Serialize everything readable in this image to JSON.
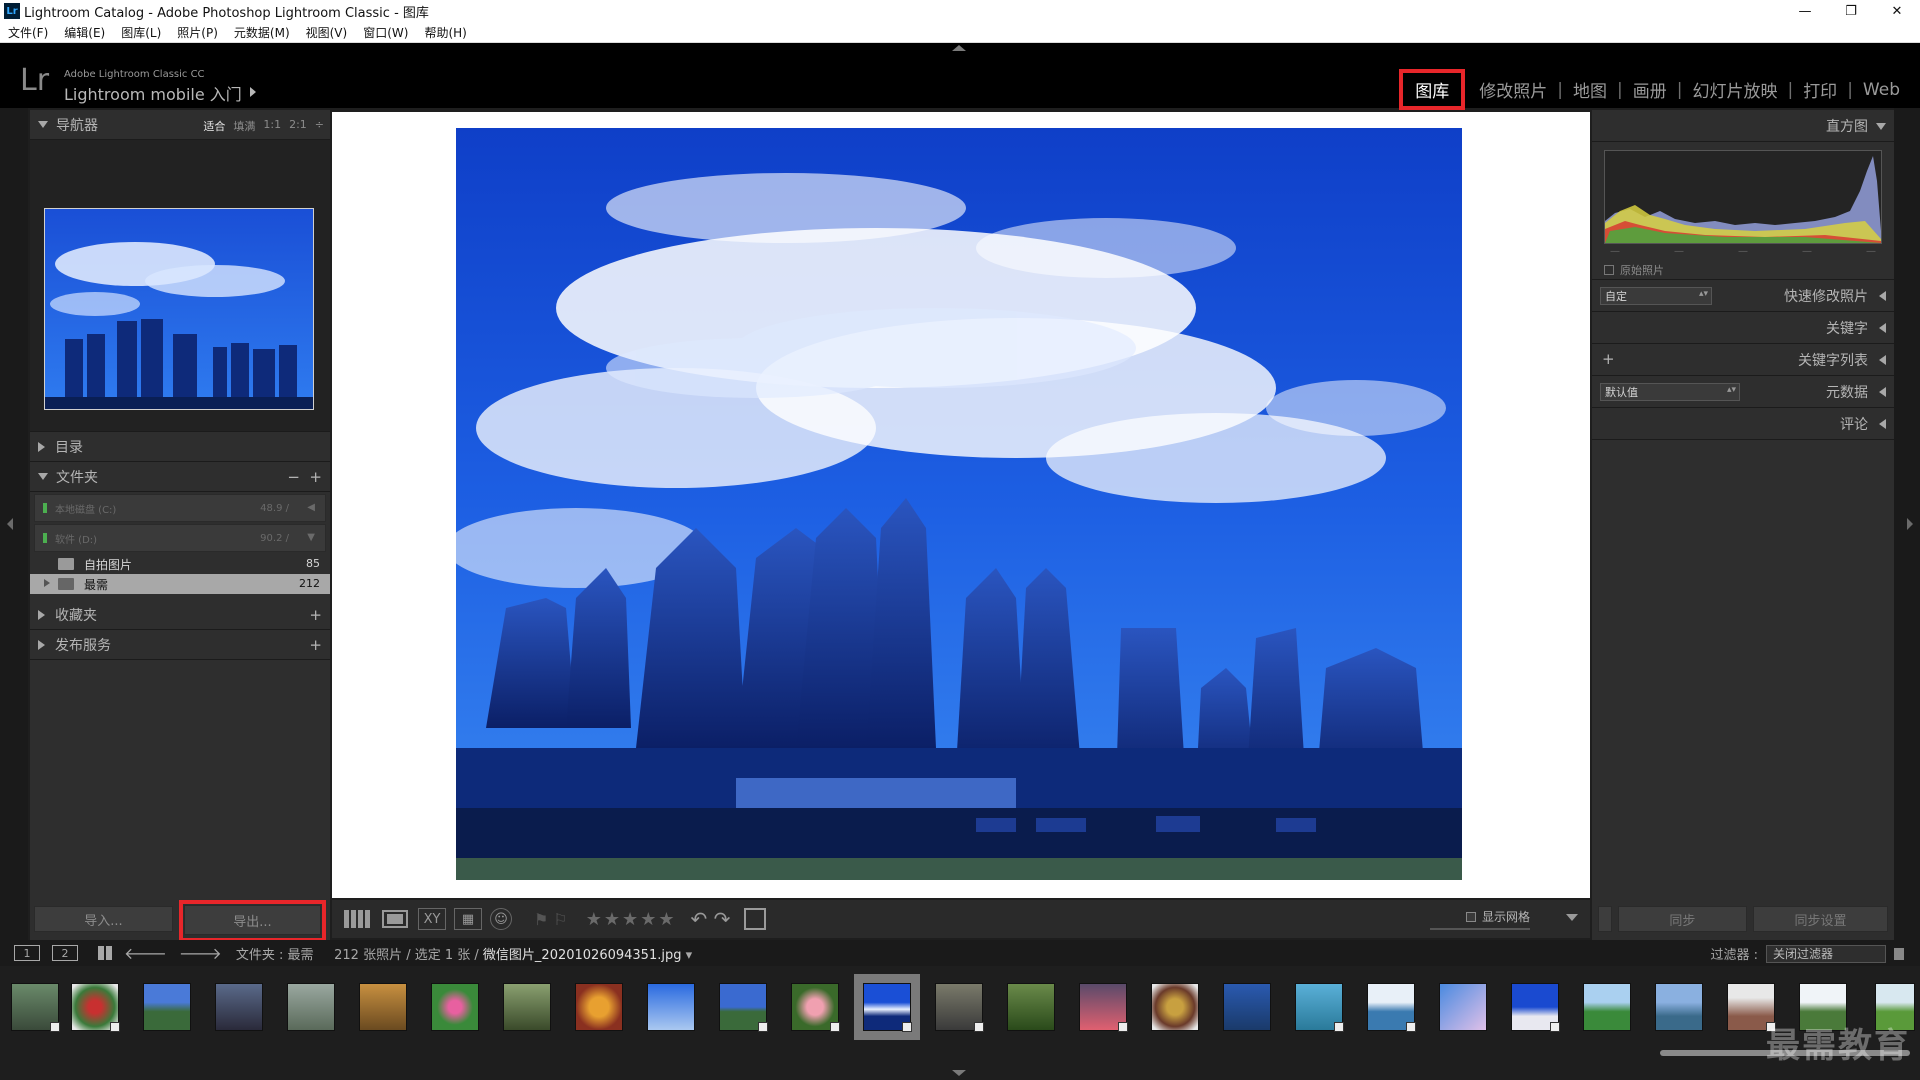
{
  "window": {
    "title": "Lightroom Catalog - Adobe Photoshop Lightroom Classic - 图库",
    "app_icon": "Lr",
    "controls": {
      "minimize": "—",
      "restore": "❐",
      "close": "✕"
    }
  },
  "menubar": [
    "文件(F)",
    "编辑(E)",
    "图库(L)",
    "照片(P)",
    "元数据(M)",
    "视图(V)",
    "窗口(W)",
    "帮助(H)"
  ],
  "identity": {
    "logo": "Lr",
    "small": "Adobe Lightroom Classic CC",
    "big": "Lightroom mobile 入门"
  },
  "modules": [
    "图库",
    "修改照片",
    "地图",
    "画册",
    "幻灯片放映",
    "打印",
    "Web"
  ],
  "active_module": "图库",
  "navigator": {
    "title": "导航器",
    "zoom": [
      "适合",
      "填满",
      "1:1",
      "2:1"
    ],
    "zoom_more": "÷"
  },
  "catalog": {
    "title": "目录"
  },
  "folders": {
    "title": "文件夹",
    "minus": "−",
    "plus": "+",
    "volumes": [
      {
        "label": "本地磁盘 (C:)",
        "size": "48.9 /",
        "arrow": "◀"
      },
      {
        "label": "软件 (D:)",
        "size": "90.2 /",
        "arrow": "▼"
      }
    ],
    "items": [
      {
        "label": "自拍图片",
        "count": "85"
      },
      {
        "label": "最需",
        "count": "212"
      }
    ]
  },
  "collections": {
    "title": "收藏夹",
    "plus": "+"
  },
  "publish": {
    "title": "发布服务",
    "plus": "+"
  },
  "left_buttons": {
    "import": "导入...",
    "export": "导出..."
  },
  "toolbar": {
    "flags": "⚑ ⚐",
    "stars": "★★★★★",
    "rotate": "↶ ↷",
    "grid_label": "显示网格"
  },
  "right_panel": {
    "histogram": "直方图",
    "original_photo": "原始照片",
    "quick_develop": {
      "title": "快速修改照片",
      "preset": "自定"
    },
    "keywording": "关键字",
    "keyword_list": {
      "title": "关键字列表",
      "plus": "+"
    },
    "metadata": {
      "title": "元数据",
      "preset": "默认值"
    },
    "comments": "评论",
    "sync": "同步",
    "sync_settings": "同步设置"
  },
  "filmstrip_bar": {
    "screen1": "1",
    "screen2": "2",
    "path_prefix": "文件夹 : 最需",
    "count": "212 张照片 / 选定 1 张 /",
    "file": "微信图片_20201026094351.jpg",
    "file_arrow": "▾",
    "filter_label": "过滤器 :",
    "filter_value": "关闭过滤器"
  },
  "watermark": "最需教育",
  "colors": {
    "active_highlight": "#e8262a",
    "panel_bg": "#2e2e2e",
    "viewer_bg": "#ffffff",
    "sky_blue": "#1c5fe0"
  }
}
